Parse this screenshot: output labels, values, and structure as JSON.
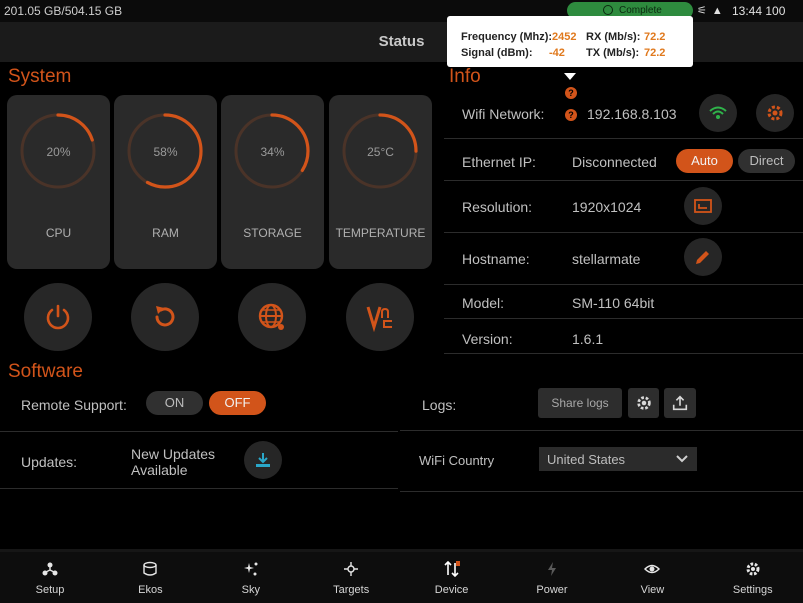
{
  "status_bar": {
    "storage": "201.05 GB/504.15 GB",
    "pill": "Complete",
    "time": "13:44 100"
  },
  "header": {
    "title": "Status"
  },
  "system": {
    "title": "System",
    "gauges": [
      {
        "label": "CPU",
        "value": "20%",
        "percent": 0.2
      },
      {
        "label": "RAM",
        "value": "58%",
        "percent": 0.58
      },
      {
        "label": "STORAGE",
        "value": "34%",
        "percent": 0.34
      },
      {
        "label": "TEMPERATURE",
        "value": "25°C",
        "percent": 0.25
      }
    ],
    "actions": [
      "power-icon",
      "restart-icon",
      "globe-icon",
      "vnc-icon"
    ]
  },
  "software": {
    "title": "Software",
    "remote_support": {
      "label": "Remote Support:",
      "on": "ON",
      "off": "OFF"
    },
    "updates": {
      "label": "Updates:",
      "value_line1": "New Updates",
      "value_line2": "Available"
    }
  },
  "info": {
    "title": "Info",
    "wifi": {
      "label": "Wifi Network:",
      "value": "192.168.8.103"
    },
    "ethernet": {
      "label": "Ethernet IP:",
      "value": "Disconnected",
      "auto": "Auto",
      "direct": "Direct"
    },
    "resolution": {
      "label": "Resolution:",
      "value": "1920x1024"
    },
    "hostname": {
      "label": "Hostname:",
      "value": "stellarmate"
    },
    "model": {
      "label": "Model:",
      "value": "SM-110 64bit"
    },
    "version": {
      "label": "Version:",
      "value": "1.6.1"
    },
    "logs": {
      "label": "Logs:",
      "share": "Share logs"
    },
    "wifi_country": {
      "label": "WiFi Country",
      "value": "United States"
    }
  },
  "tooltip": {
    "freq_label": "Frequency (Mhz):",
    "freq_value": "2452",
    "signal_label": "Signal (dBm):",
    "signal_value": "-42",
    "rx_label": "RX (Mb/s):",
    "rx_value": "72.2",
    "tx_label": "TX (Mb/s):",
    "tx_value": "72.2",
    "q": "?"
  },
  "nav": [
    "Setup",
    "Ekos",
    "Sky",
    "Targets",
    "Device",
    "Power",
    "View",
    "Settings"
  ],
  "colors": {
    "accent": "#d2541a",
    "background": "#000000",
    "card": "#2a2a2a",
    "status_pill": "#2e8b3e"
  }
}
